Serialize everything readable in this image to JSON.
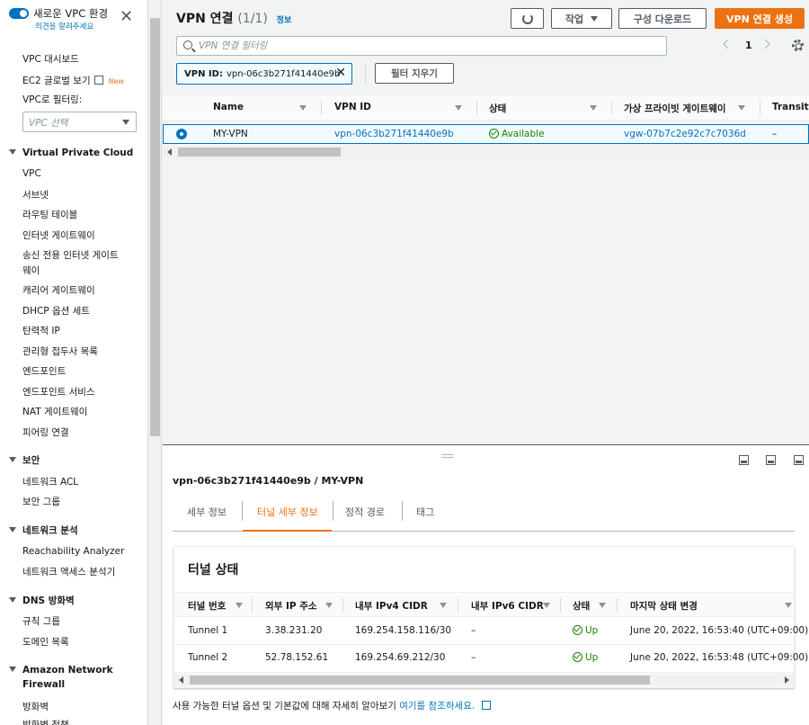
{
  "sidebar": {
    "toggle_title": "새로운 VPC 환경",
    "toggle_sub": "의견을 알려주세요",
    "links_top": [
      "VPC 대시보드",
      "EC2 글로벌 보기"
    ],
    "new_badge": "New",
    "filter_label": "VPC로 필터링:",
    "filter_placeholder": "VPC 선택",
    "sections": [
      {
        "title": "Virtual Private Cloud",
        "items": [
          "VPC",
          "서브넷",
          "라우팅 테이블",
          "인터넷 게이트웨이",
          "송신 전용 인터넷 게이트",
          "웨이",
          "캐리어 게이트웨이",
          "DHCP 옵션 세트",
          "탄력적 IP",
          "관리형 접두사 목록",
          "엔드포인트",
          "엔드포인트 서비스",
          "NAT 게이트웨이",
          "피어링 연결"
        ]
      },
      {
        "title": "보안",
        "items": [
          "네트워크 ACL",
          "보안 그룹"
        ]
      },
      {
        "title": "네트워크 분석",
        "items": [
          "Reachability Analyzer",
          "네트워크 액세스 분석기"
        ]
      },
      {
        "title": "DNS 방화벽",
        "items": [
          "규칙 그룹",
          "도메인 목록"
        ]
      },
      {
        "title_lines": [
          "Amazon Network",
          "Firewall"
        ],
        "items": [
          "방화벽",
          "방화벽 정책"
        ]
      }
    ]
  },
  "main": {
    "title": "VPN 연결",
    "count": "(1/1)",
    "info": "정보",
    "actions_label": "작업",
    "download_label": "구성 다운로드",
    "create_label": "VPN 연결 생성",
    "search_placeholder": "VPN 연결 필터링",
    "page": "1",
    "filter_token_key": "VPN ID:",
    "filter_token_value": "vpn-06c3b271f41440e9b",
    "clear_filters_label": "필터 지우기",
    "columns": [
      "Name",
      "VPN ID",
      "상태",
      "가상 프라이빗 게이트웨이",
      "Transit G"
    ],
    "row": {
      "name": "MY-VPN",
      "vpn_id": "vpn-06c3b271f41440e9b",
      "state": "Available",
      "vgw": "vgw-07b7c2e92c7c7036d",
      "transit": "–"
    }
  },
  "split": {
    "title": "vpn-06c3b271f41440e9b / MY-VPN",
    "tabs": [
      "세부 정보",
      "터널 세부 정보",
      "정적 경로",
      "태그"
    ],
    "active_tab": 1,
    "card_title": "터널 상태",
    "columns": [
      "터널 번호",
      "외부 IP 주소",
      "내부 IPv4 CIDR",
      "내부 IPv6 CIDR",
      "상태",
      "마지막 상태 변경"
    ],
    "rows": [
      {
        "tunnel": "Tunnel 1",
        "outside_ip": "3.38.231.20",
        "ipv4": "169.254.158.116/30",
        "ipv6": "–",
        "status": "Up",
        "changed": "June 20, 2022, 16:53:40 (UTC+09:00)"
      },
      {
        "tunnel": "Tunnel 2",
        "outside_ip": "52.78.152.61",
        "ipv4": "169.254.69.212/30",
        "ipv6": "–",
        "status": "Up",
        "changed": "June 20, 2022, 16:53:48 (UTC+09:00)"
      }
    ],
    "footer_text": "사용 가능한 터널 옵션 및 기본값에 대해 자세히 알아보기",
    "footer_link": "여기를 참조하세요."
  },
  "colors": {
    "accent": "#ec7211",
    "link": "#0073bb",
    "success": "#1d8102"
  }
}
